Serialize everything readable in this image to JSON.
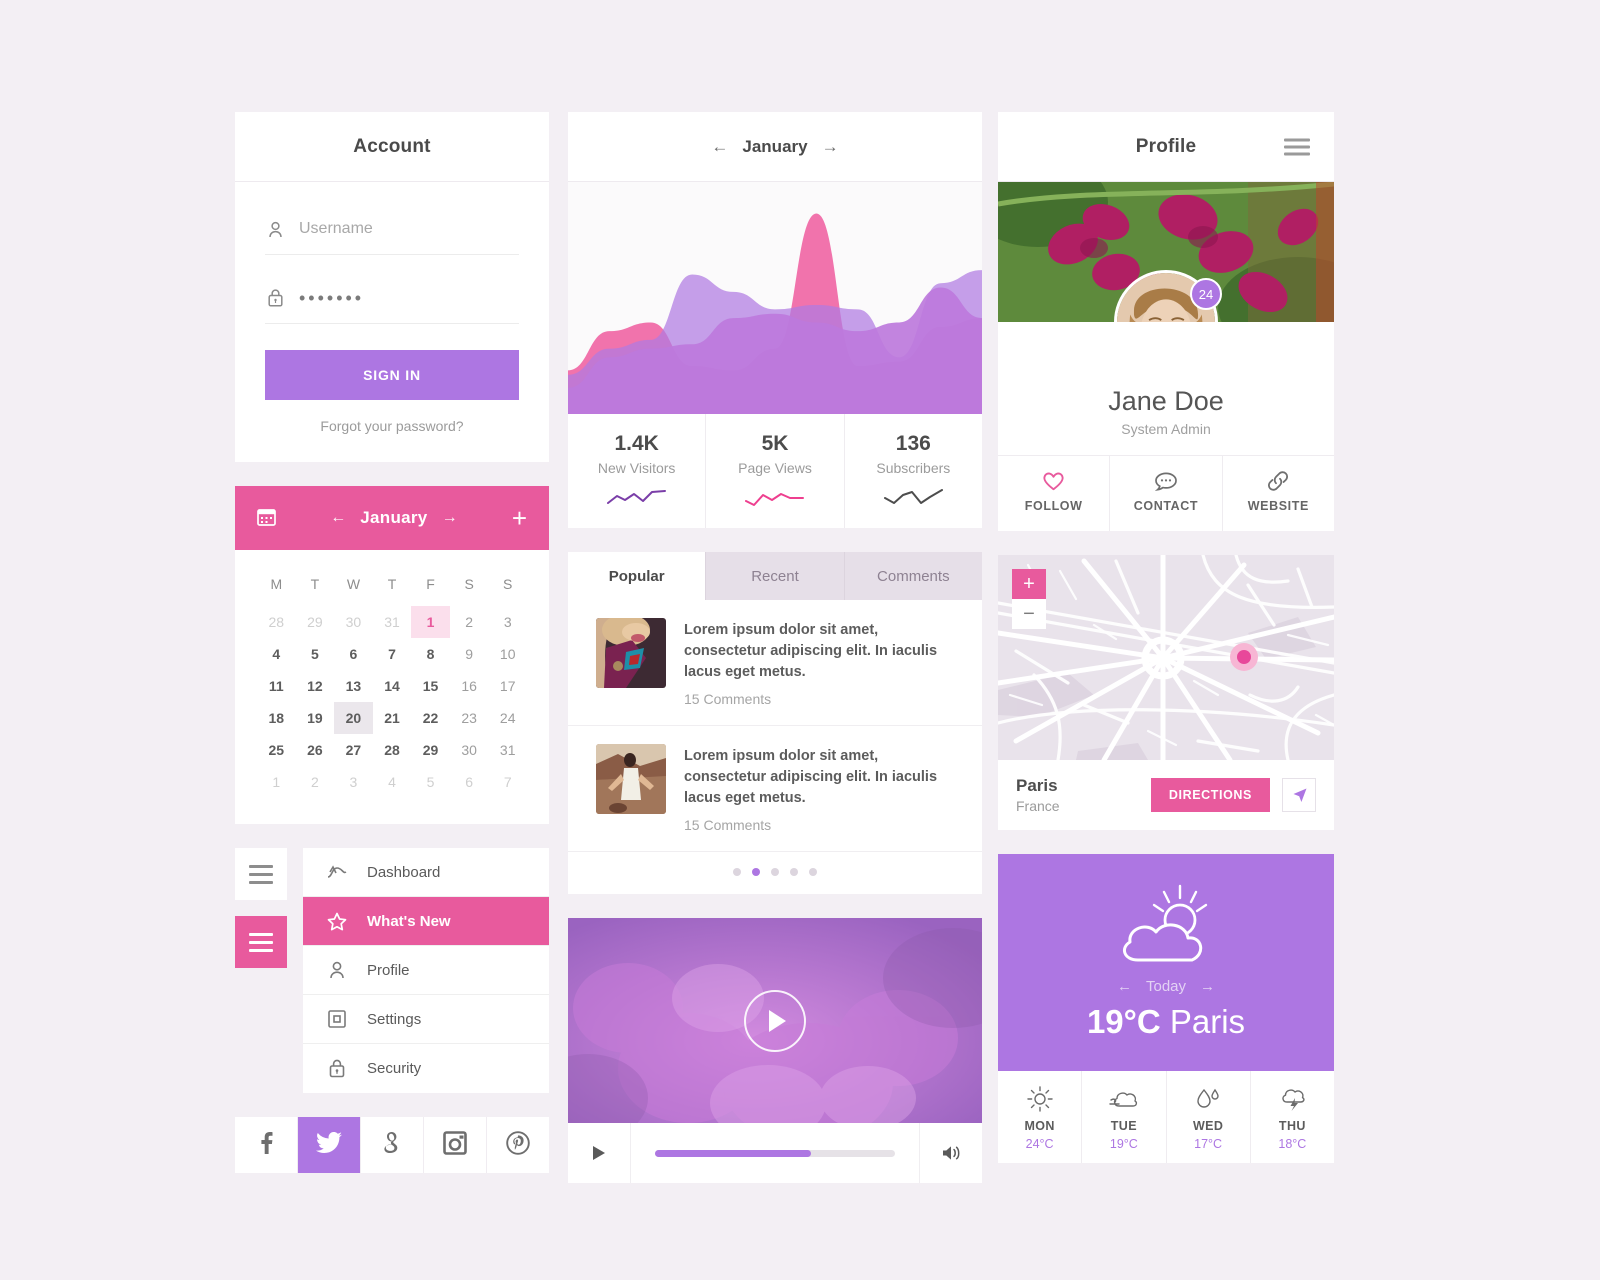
{
  "theme": {
    "purple": "#ad76e2",
    "pink": "#e85a9d",
    "bg": "#f3eff4",
    "card": "#ffffff"
  },
  "account": {
    "title": "Account",
    "username_placeholder": "Username",
    "username_value": "",
    "password_value": "•••••••",
    "signin_label": "SIGN IN",
    "forgot_label": "Forgot your password?",
    "user_icon": "user-icon",
    "lock_icon": "lock-icon"
  },
  "calendar": {
    "month": "January",
    "prev_arrow": "←",
    "next_arrow": "→",
    "add_label": "+",
    "calendar_icon": "calendar-icon",
    "dow": [
      "M",
      "T",
      "W",
      "T",
      "F",
      "S",
      "S"
    ],
    "weeks": [
      [
        {
          "d": "28",
          "t": "mut"
        },
        {
          "d": "29",
          "t": "mut"
        },
        {
          "d": "30",
          "t": "mut"
        },
        {
          "d": "31",
          "t": "mut"
        },
        {
          "d": "1",
          "t": "sel-pink"
        },
        {
          "d": "2",
          "t": "we"
        },
        {
          "d": "3",
          "t": "we"
        }
      ],
      [
        {
          "d": "4",
          "t": ""
        },
        {
          "d": "5",
          "t": ""
        },
        {
          "d": "6",
          "t": ""
        },
        {
          "d": "7",
          "t": ""
        },
        {
          "d": "8",
          "t": ""
        },
        {
          "d": "9",
          "t": "we"
        },
        {
          "d": "10",
          "t": "we"
        }
      ],
      [
        {
          "d": "11",
          "t": ""
        },
        {
          "d": "12",
          "t": ""
        },
        {
          "d": "13",
          "t": ""
        },
        {
          "d": "14",
          "t": ""
        },
        {
          "d": "15",
          "t": ""
        },
        {
          "d": "16",
          "t": "we"
        },
        {
          "d": "17",
          "t": "we"
        }
      ],
      [
        {
          "d": "18",
          "t": ""
        },
        {
          "d": "19",
          "t": ""
        },
        {
          "d": "20",
          "t": "sel-gray"
        },
        {
          "d": "21",
          "t": ""
        },
        {
          "d": "22",
          "t": ""
        },
        {
          "d": "23",
          "t": "we"
        },
        {
          "d": "24",
          "t": "we"
        }
      ],
      [
        {
          "d": "25",
          "t": ""
        },
        {
          "d": "26",
          "t": ""
        },
        {
          "d": "27",
          "t": ""
        },
        {
          "d": "28",
          "t": ""
        },
        {
          "d": "29",
          "t": ""
        },
        {
          "d": "30",
          "t": "we"
        },
        {
          "d": "31",
          "t": "we"
        }
      ],
      [
        {
          "d": "1",
          "t": "mut"
        },
        {
          "d": "2",
          "t": "mut"
        },
        {
          "d": "3",
          "t": "mut"
        },
        {
          "d": "4",
          "t": "mut"
        },
        {
          "d": "5",
          "t": "mut"
        },
        {
          "d": "6",
          "t": "mut"
        },
        {
          "d": "7",
          "t": "mut"
        }
      ]
    ]
  },
  "menu": {
    "items": [
      {
        "label": "Dashboard",
        "icon": "dashboard-icon",
        "active": false
      },
      {
        "label": "What's New",
        "icon": "star-icon",
        "active": true
      },
      {
        "label": "Profile",
        "icon": "user-icon",
        "active": false
      },
      {
        "label": "Settings",
        "icon": "settings-icon",
        "active": false
      },
      {
        "label": "Security",
        "icon": "lock-icon",
        "active": false
      }
    ]
  },
  "social": [
    {
      "name": "facebook-icon",
      "glyph": "f",
      "active": false
    },
    {
      "name": "twitter-icon",
      "glyph": "t",
      "active": true
    },
    {
      "name": "google-plus-icon",
      "glyph": "g",
      "active": false
    },
    {
      "name": "instagram-icon",
      "glyph": "i",
      "active": false
    },
    {
      "name": "pinterest-icon",
      "glyph": "p",
      "active": false
    }
  ],
  "analytics": {
    "month": "January",
    "prev_arrow": "←",
    "next_arrow": "→",
    "stats": [
      {
        "num": "1.4K",
        "label": "New Visitors",
        "spark_color": "#7a3ea8"
      },
      {
        "num": "5K",
        "label": "Page Views",
        "spark_color": "#ee3f8f"
      },
      {
        "num": "136",
        "label": "Subscribers",
        "spark_color": "#4d4d4d"
      }
    ]
  },
  "chart_data": {
    "type": "area",
    "title": "January",
    "xlabel": "",
    "ylabel": "",
    "grid": false,
    "legend": "none",
    "ylim": [
      0,
      100
    ],
    "x": [
      0,
      10,
      20,
      30,
      40,
      50,
      60,
      70,
      80,
      90,
      100
    ],
    "series": [
      {
        "name": "Series A (pink)",
        "color": "#ee5a9e",
        "opacity": 0.85,
        "values": [
          20,
          38,
          42,
          22,
          20,
          30,
          92,
          22,
          24,
          40,
          44
        ]
      },
      {
        "name": "Series B (light purple)",
        "color": "#b07ae2",
        "opacity": 0.72,
        "values": [
          18,
          30,
          34,
          64,
          56,
          48,
          50,
          48,
          26,
          60,
          66
        ]
      },
      {
        "name": "Series C (purple)",
        "color": "#bd7adc",
        "opacity": 0.92,
        "values": [
          12,
          26,
          30,
          32,
          44,
          46,
          42,
          38,
          42,
          58,
          44
        ]
      }
    ]
  },
  "posts": {
    "tabs": [
      {
        "label": "Popular",
        "active": true
      },
      {
        "label": "Recent",
        "active": false
      },
      {
        "label": "Comments",
        "active": false
      }
    ],
    "items": [
      {
        "title": "Lorem ipsum dolor sit amet, consectetur adipiscing elit. In iaculis lacus eget metus.",
        "meta": "15 Comments"
      },
      {
        "title": "Lorem ipsum dolor sit amet, consectetur adipiscing elit. In iaculis lacus eget metus.",
        "meta": "15 Comments"
      }
    ],
    "pager": {
      "count": 5,
      "active": 1
    }
  },
  "video": {
    "play_icon": "play-icon",
    "small_play_icon": "play-icon",
    "volume_icon": "volume-icon",
    "progress_percent": 65
  },
  "profile": {
    "title": "Profile",
    "menu_icon": "hamburger-icon",
    "name": "Jane Doe",
    "role": "System Admin",
    "badge_count": "24",
    "actions": [
      {
        "label": "FOLLOW",
        "icon": "heart-icon"
      },
      {
        "label": "CONTACT",
        "icon": "comment-icon"
      },
      {
        "label": "WEBSITE",
        "icon": "link-icon"
      }
    ]
  },
  "map": {
    "zoom_in_label": "+",
    "zoom_out_label": "−",
    "pin_icon": "map-pin-icon",
    "city": "Paris",
    "country": "France",
    "directions_label": "DIRECTIONS",
    "navigate_icon": "navigation-arrow-icon"
  },
  "weather": {
    "icon": "sun-behind-cloud-icon",
    "prev_arrow": "←",
    "next_arrow": "→",
    "today_label": "Today",
    "temperature": "19°C",
    "city": "Paris",
    "forecast": [
      {
        "day": "MON",
        "temp": "24°C",
        "icon": "sun-icon"
      },
      {
        "day": "TUE",
        "temp": "19°C",
        "icon": "windy-cloud-icon"
      },
      {
        "day": "WED",
        "temp": "17°C",
        "icon": "rain-drops-icon"
      },
      {
        "day": "THU",
        "temp": "18°C",
        "icon": "thunderstorm-icon"
      }
    ]
  }
}
